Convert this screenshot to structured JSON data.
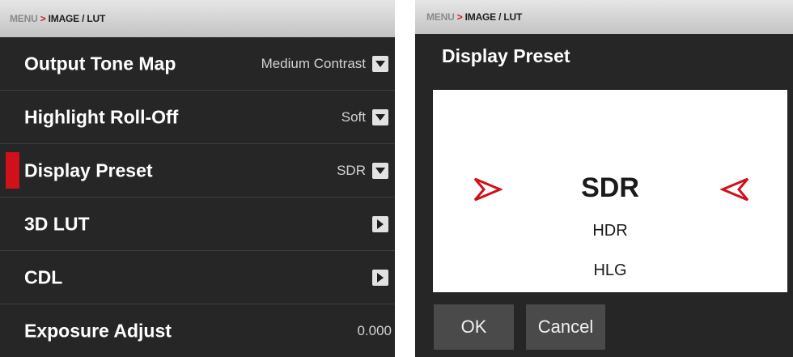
{
  "left": {
    "breadcrumb": {
      "menu": "MENU",
      "separator": ">",
      "page": "IMAGE / LUT"
    },
    "rows": [
      {
        "label": "Output Tone Map",
        "value": "Medium Contrast"
      },
      {
        "label": "Highlight Roll-Off",
        "value": "Soft"
      },
      {
        "label": "Display Preset",
        "value": "SDR"
      },
      {
        "label": "3D LUT"
      },
      {
        "label": "CDL"
      },
      {
        "label": "Exposure Adjust",
        "value": "0.000"
      }
    ]
  },
  "right": {
    "breadcrumb": {
      "menu": "MENU",
      "separator": ">",
      "page": "IMAGE / LUT"
    },
    "title": "Display Preset",
    "options": [
      "SDR",
      "HDR",
      "HLG"
    ],
    "ok_label": "OK",
    "cancel_label": "Cancel"
  },
  "colors": {
    "accent": "#d0101a",
    "panel": "#262626",
    "picker": "#ffffff"
  },
  "icons": {
    "dropdown": "chevron-down-icon",
    "submenu": "chevron-right-icon",
    "picker_left": "arrow-right-icon",
    "picker_right": "arrow-left-icon"
  }
}
